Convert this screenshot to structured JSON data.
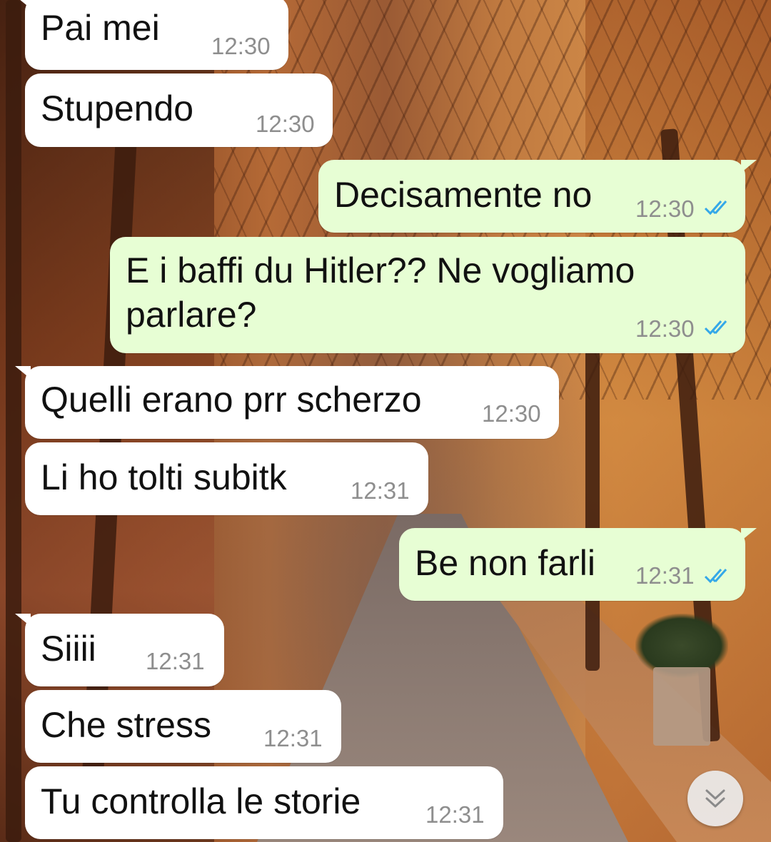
{
  "colors": {
    "incoming_bubble": "#ffffff",
    "outgoing_bubble": "#e7fed4",
    "read_ticks": "#34a8e8",
    "timestamp": "#8e8e8e"
  },
  "messages": [
    {
      "direction": "incoming",
      "text": "Pai mei",
      "time": "12:30"
    },
    {
      "direction": "incoming",
      "text": "Stupendo",
      "time": "12:30"
    },
    {
      "direction": "outgoing",
      "text": "Decisamente no",
      "time": "12:30",
      "status": "read-double-check-icon"
    },
    {
      "direction": "outgoing",
      "text_lines": [
        "E i baffi du Hitler?? Ne vogliamo",
        "parlare?"
      ],
      "time": "12:30",
      "status": "read-double-check-icon"
    },
    {
      "direction": "incoming",
      "text": "Quelli erano prr scherzo",
      "time": "12:30"
    },
    {
      "direction": "incoming",
      "text": "Li ho tolti subitk",
      "time": "12:31"
    },
    {
      "direction": "outgoing",
      "text": "Be non farli",
      "time": "12:31",
      "status": "read-double-check-icon"
    },
    {
      "direction": "incoming",
      "text": "Siiii",
      "time": "12:31"
    },
    {
      "direction": "incoming",
      "text": "Che stress",
      "time": "12:31"
    },
    {
      "direction": "incoming",
      "text": "Tu controlla le storie",
      "time": "12:31"
    }
  ],
  "scroll_button": {
    "icon": "double-chevron-down-icon"
  }
}
